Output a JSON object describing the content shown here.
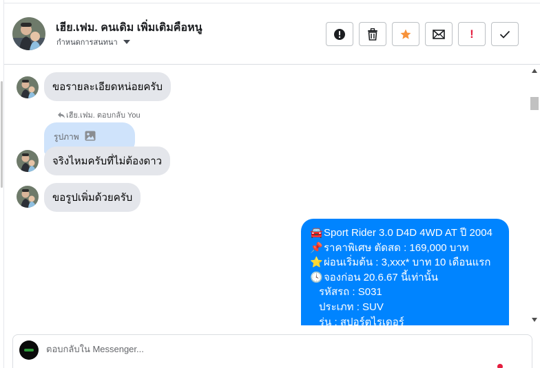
{
  "header": {
    "contact_name": "เฮีย.เฟม. คนเดิม เพิ่มเติมคือหนู",
    "conversation_settings": "กำหนดการสนทนา",
    "actions": [
      {
        "name": "report-button",
        "icon": "alert-circle-icon"
      },
      {
        "name": "delete-button",
        "icon": "trash-icon"
      },
      {
        "name": "star-button",
        "icon": "star-icon"
      },
      {
        "name": "mark-unread-button",
        "icon": "envelope-icon"
      },
      {
        "name": "important-button",
        "icon": "exclamation-icon",
        "label": "!"
      },
      {
        "name": "done-button",
        "icon": "check-icon"
      }
    ]
  },
  "messages": {
    "incoming_1": "ขอรายละเอียดหน่อยครับ",
    "reply_meta": "เฮีย.เฟม. ตอบกลับ You",
    "reply_quote_label": "รูปภาพ",
    "incoming_2": "จริงไหมครับที่ไม่ต้องดาว",
    "incoming_3": "ขอรูปเพิ่มด้วยครับ",
    "outgoing_lines": [
      {
        "emoji": "🚘",
        "text": "Sport Rider 3.0 D4D 4WD AT ปี 2004"
      },
      {
        "emoji": "📌",
        "text": "ราคาพิเศษ ตัดสด : 169,000 บาท"
      },
      {
        "emoji": "⭐",
        "text": "ผ่อนเริ่มต้น : 3,xxx* บาท 10 เดือนแรก"
      },
      {
        "emoji": "🕓",
        "text": "จองก่อน 20.6.67 นี้เท่านั้น"
      },
      {
        "emoji": "",
        "text": "รหัสรถ : S031"
      },
      {
        "emoji": "",
        "text": "ประเภท : SUV"
      },
      {
        "emoji": "",
        "text": "รุ่น : สปอร์ตไรเดอร์"
      }
    ]
  },
  "composer": {
    "placeholder": "ตอบกลับใน Messenger..."
  },
  "colors": {
    "outgoing_bubble": "#0084ff",
    "incoming_bubble": "#e4e6eb",
    "reply_quote": "#cfe3fb",
    "star": "#f7923a",
    "important": "#e41e3f"
  }
}
